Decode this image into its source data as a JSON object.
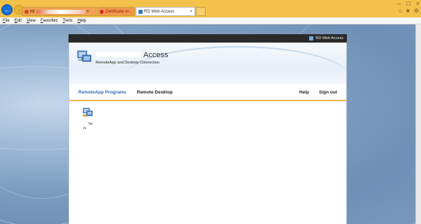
{
  "browser": {
    "tabs": [
      {
        "label": "htt",
        "state": "inactive"
      },
      {
        "label": "Certificate er...",
        "state": "inactive"
      },
      {
        "label": "RD Web Access",
        "state": "active"
      }
    ],
    "close_glyph": "×",
    "menu": [
      "File",
      "Edit",
      "View",
      "Favorites",
      "Tools",
      "Help"
    ],
    "window_controls": [
      "–",
      "□",
      "×"
    ],
    "toolbar_icons": [
      "home-icon",
      "star-icon",
      "gear-icon"
    ]
  },
  "rdweb": {
    "top_label": "RD Web Access",
    "title": "Access",
    "subtitle": "RemoteApp and Desktop Connection",
    "nav": {
      "remoteapp": "RemoteApp Programs",
      "desktop": "Remote Desktop",
      "help": "Help",
      "signout": "Sign out"
    },
    "apps": [
      {
        "label_line1": "’for",
        "label_line2": "(s"
      }
    ]
  },
  "colors": {
    "chrome": "#f2c24b",
    "accent_blue": "#2e6ab0",
    "nav_underline": "#f2b24a"
  }
}
